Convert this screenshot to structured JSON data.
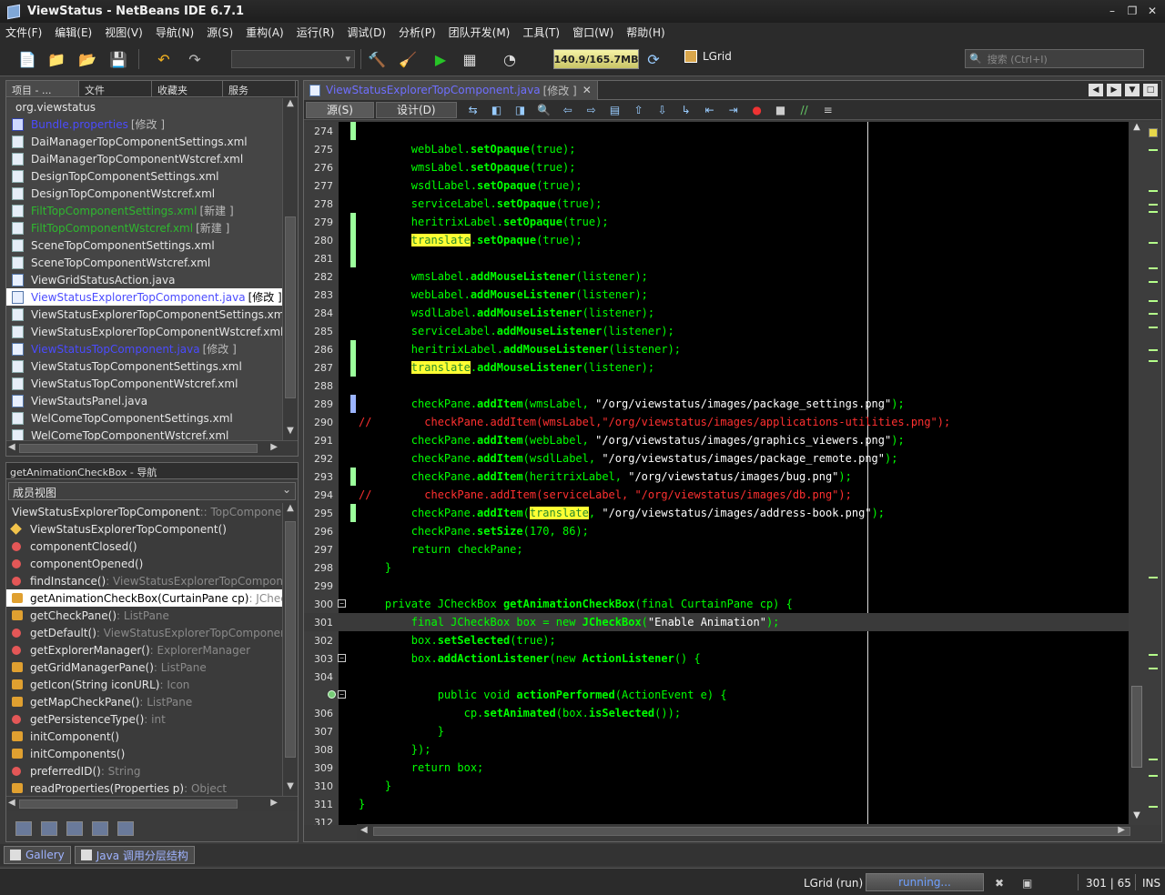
{
  "window": {
    "title": "ViewStatus - NetBeans IDE 6.7.1"
  },
  "menu": [
    "文件(F)",
    "编辑(E)",
    "视图(V)",
    "导航(N)",
    "源(S)",
    "重构(A)",
    "运行(R)",
    "调试(D)",
    "分析(P)",
    "团队开发(M)",
    "工具(T)",
    "窗口(W)",
    "帮助(H)"
  ],
  "toolbar": {
    "memory": "140.9/165.7MB",
    "project": "LGrid",
    "search_placeholder": "搜索 (Ctrl+I)"
  },
  "projects": {
    "tabs": [
      "项目 - ...",
      "文件",
      "收藏夹",
      "服务"
    ],
    "root": "org.viewstatus",
    "files": [
      {
        "name": "Bundle.properties",
        "tag": "[修改 ]",
        "state": "mod"
      },
      {
        "name": "DaiManagerTopComponentSettings.xml",
        "tag": "",
        "state": ""
      },
      {
        "name": "DaiManagerTopComponentWstcref.xml",
        "tag": "",
        "state": ""
      },
      {
        "name": "DesignTopComponentSettings.xml",
        "tag": "",
        "state": ""
      },
      {
        "name": "DesignTopComponentWstcref.xml",
        "tag": "",
        "state": ""
      },
      {
        "name": "FiltTopComponentSettings.xml",
        "tag": "[新建 ]",
        "state": "new"
      },
      {
        "name": "FiltTopComponentWstcref.xml",
        "tag": "[新建 ]",
        "state": "new"
      },
      {
        "name": "SceneTopComponentSettings.xml",
        "tag": "",
        "state": ""
      },
      {
        "name": "SceneTopComponentWstcref.xml",
        "tag": "",
        "state": ""
      },
      {
        "name": "ViewGridStatusAction.java",
        "tag": "",
        "state": ""
      },
      {
        "name": "ViewStatusExplorerTopComponent.java",
        "tag": "[修改 ]",
        "state": "sel"
      },
      {
        "name": "ViewStatusExplorerTopComponentSettings.xml",
        "tag": "",
        "state": ""
      },
      {
        "name": "ViewStatusExplorerTopComponentWstcref.xml",
        "tag": "",
        "state": ""
      },
      {
        "name": "ViewStatusTopComponent.java",
        "tag": "[修改 ]",
        "state": "mod"
      },
      {
        "name": "ViewStatusTopComponentSettings.xml",
        "tag": "",
        "state": ""
      },
      {
        "name": "ViewStatusTopComponentWstcref.xml",
        "tag": "",
        "state": ""
      },
      {
        "name": "ViewStautsPanel.java",
        "tag": "",
        "state": ""
      },
      {
        "name": "WelComeTopComponentSettings.xml",
        "tag": "",
        "state": ""
      },
      {
        "name": "WelComeTopComponentWstcref.xml",
        "tag": "",
        "state": ""
      }
    ]
  },
  "navigator": {
    "title": "getAnimationCheckBox - 导航",
    "view": "成员视图",
    "members": [
      {
        "icon": "none",
        "name": "ViewStatusExplorerTopComponent",
        "type": " :: TopComponent"
      },
      {
        "icon": "dia",
        "name": "ViewStatusExplorerTopComponent()",
        "type": ""
      },
      {
        "icon": "dot",
        "name": "componentClosed()",
        "type": ""
      },
      {
        "icon": "dot",
        "name": "componentOpened()",
        "type": ""
      },
      {
        "icon": "dot",
        "name": "findInstance()",
        "type": " : ViewStatusExplorerTopComponent"
      },
      {
        "icon": "lk",
        "name": "getAnimationCheckBox(CurtainPane cp)",
        "type": " : JCheckBox",
        "sel": true
      },
      {
        "icon": "lk",
        "name": "getCheckPane()",
        "type": " : ListPane"
      },
      {
        "icon": "dot",
        "name": "getDefault()",
        "type": " : ViewStatusExplorerTopComponent"
      },
      {
        "icon": "dot",
        "name": "getExplorerManager()",
        "type": " : ExplorerManager"
      },
      {
        "icon": "lk",
        "name": "getGridManagerPane()",
        "type": " : ListPane"
      },
      {
        "icon": "lk",
        "name": "getIcon(String iconURL)",
        "type": " : Icon"
      },
      {
        "icon": "lk",
        "name": "getMapCheckPane()",
        "type": " : ListPane"
      },
      {
        "icon": "dot",
        "name": "getPersistenceType()",
        "type": " : int"
      },
      {
        "icon": "lk",
        "name": "initComponent()",
        "type": ""
      },
      {
        "icon": "lk",
        "name": "initComponents()",
        "type": ""
      },
      {
        "icon": "dot",
        "name": "preferredID()",
        "type": " : String"
      },
      {
        "icon": "lk",
        "name": "readProperties(Properties p)",
        "type": " : Object"
      }
    ]
  },
  "editor": {
    "tab": "ViewStatusExplorerTopComponent.java",
    "tab_tag": "[修改 ]",
    "source_btn": "源(S)",
    "design_btn": "设计(D)"
  },
  "bottom": {
    "gallery": "Gallery",
    "hierarchy": "Java 调用分层结构"
  },
  "status": {
    "project": "LGrid (run)",
    "progress": "running...",
    "position": "301 | 65",
    "mode": "INS"
  }
}
